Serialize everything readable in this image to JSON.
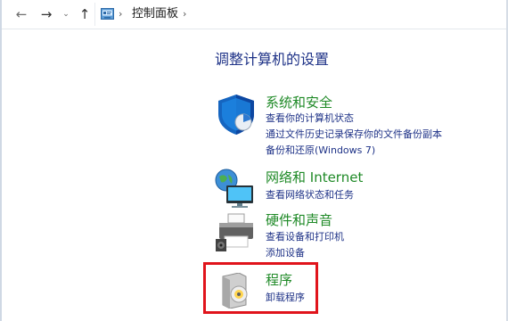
{
  "nav": {
    "back_icon": "←",
    "forward_icon": "→",
    "recent_icon": "⌄",
    "up_icon": "↑",
    "separator": "›",
    "breadcrumb": "控制面板"
  },
  "page_title": "调整计算机的设置",
  "categories": [
    {
      "title": "系统和安全",
      "icon": "shield-icon",
      "links": [
        "查看你的计算机状态",
        "通过文件历史记录保存你的文件备份副本",
        "备份和还原(Windows 7)"
      ]
    },
    {
      "title": "网络和 Internet",
      "icon": "network-globe-icon",
      "links": [
        "查看网络状态和任务"
      ]
    },
    {
      "title": "硬件和声音",
      "icon": "printer-speaker-icon",
      "links": [
        "查看设备和打印机",
        "添加设备"
      ]
    },
    {
      "title": "程序",
      "icon": "programs-disc-icon",
      "links": [
        "卸载程序"
      ]
    }
  ],
  "colors": {
    "category_title": "#1f8a27",
    "link": "#1e3287",
    "highlight": "#e0141b"
  }
}
